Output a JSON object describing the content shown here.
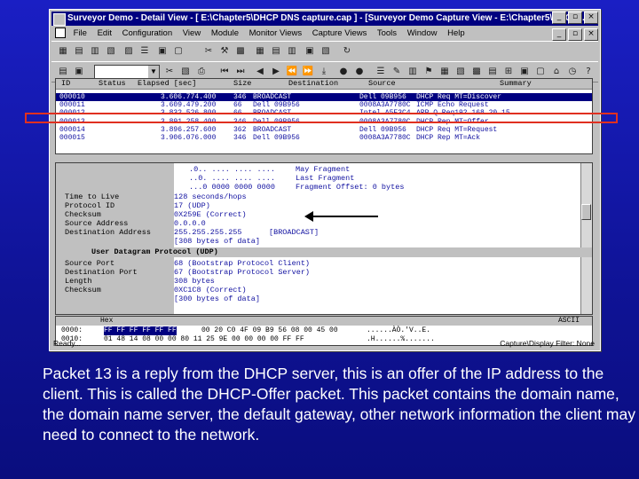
{
  "window": {
    "title": "Surveyor Demo - Detail View - [ E:\\Chapter5\\DHCP DNS capture.cap ] - [Surveyor Demo Capture View - E:\\Chapter5\\DHCP ..."
  },
  "menu": [
    "File",
    "Edit",
    "Configuration",
    "View",
    "Module",
    "Monitor Views",
    "Capture Views",
    "Tools",
    "Window",
    "Help"
  ],
  "title_buttons": [
    "_",
    "▫",
    "×"
  ],
  "mdi_buttons": [
    "_",
    "▫",
    "×"
  ],
  "packet_list": {
    "headers": [
      "ID",
      "Status",
      "Elapsed [sec]",
      "Size",
      "Destination",
      "Source",
      "Summary"
    ],
    "rows": [
      {
        "id": "000010",
        "elapsed": "3.606.774.400",
        "size": "346",
        "dest": "BROADCAST",
        "src": "Dell 09B956",
        "summary": "DHCP Req   MT=Discover"
      },
      {
        "id": "000011",
        "elapsed": "3.609.479.200",
        "size": "66",
        "dest": "Dell 09B956",
        "src": "0008A3A7780C",
        "summary": "ICMP  Echo Request"
      },
      {
        "id": "000012",
        "elapsed": "3.832.526.800",
        "size": "66",
        "dest": "BROADCAST",
        "src": "Intel A5E3C4",
        "summary": "ARP  Q Req192.168.20.15"
      },
      {
        "id": "000013",
        "elapsed": "3.891.258.400",
        "size": "346",
        "dest": "Dell 09B956",
        "src": "0008A3A7780C",
        "summary": "DHCP Rep   MT=Offer"
      },
      {
        "id": "000014",
        "elapsed": "3.896.257.600",
        "size": "362",
        "dest": "BROADCAST",
        "src": "Dell 09B956",
        "summary": "DHCP Req   MT=Request"
      },
      {
        "id": "000015",
        "elapsed": "3.906.076.000",
        "size": "346",
        "dest": "Dell 09B956",
        "src": "0008A3A7780C",
        "summary": "DHCP Rep   MT=Ack"
      }
    ]
  },
  "detail": {
    "flags": [
      {
        "bits": ".0.. .... .... ....",
        "desc": "May Fragment"
      },
      {
        "bits": "..0. .... .... ....",
        "desc": "Last Fragment"
      },
      {
        "bits": "...0 0000 0000 0000",
        "desc": "Fragment Offset: 0 bytes"
      }
    ],
    "ip_fields": [
      {
        "label": "Time to Live",
        "value": "128 seconds/hops",
        "extra": ""
      },
      {
        "label": "Protocol ID",
        "value": "17    (UDP)",
        "extra": ""
      },
      {
        "label": "Checksum",
        "value": "0X259E    (Correct)",
        "extra": ""
      },
      {
        "label": "Source Address",
        "value": "0.0.0.0",
        "extra": ""
      },
      {
        "label": "Destination Address",
        "value": "255.255.255.255",
        "extra": "[BROADCAST]"
      },
      {
        "label": "",
        "value": "[308 bytes of data]",
        "extra": ""
      }
    ],
    "udp_header": "User Datagram Protocol    (UDP)",
    "udp_fields": [
      {
        "label": "Source Port",
        "value": "68     (Bootstrap Protocol Client)"
      },
      {
        "label": "Destination Port",
        "value": "67     (Bootstrap Protocol Server)"
      },
      {
        "label": "Length",
        "value": "308 bytes"
      },
      {
        "label": "Checksum",
        "value": "0XC1C8     (Correct)"
      },
      {
        "label": "",
        "value": "[300 bytes of data]"
      }
    ]
  },
  "hex": {
    "header_left": "Hex",
    "header_right": "ASCII",
    "rows": [
      {
        "offset": "0000:",
        "sel": "FF FF FF FF FF FF",
        "bytes": "00 20 C0 4F 09 B9 56 08 00 45 00",
        "ascii": "......ÀÒ.'V..E."
      },
      {
        "offset": "0010:",
        "sel": "",
        "bytes": "01 48 14 08 00 00 80 11 25 9E 00 00 00 00 FF FF",
        "ascii": ".H......%......."
      }
    ]
  },
  "status": {
    "left": "Ready...",
    "right": "Capture\\Display Filter: None"
  },
  "caption": "Packet 13 is a reply from the DHCP server, this is an offer of the IP address  to the client. This is called the DHCP-Offer packet.  This packet contains the domain name,  the domain name server, the default gateway, other network information the client may need to connect to the network."
}
